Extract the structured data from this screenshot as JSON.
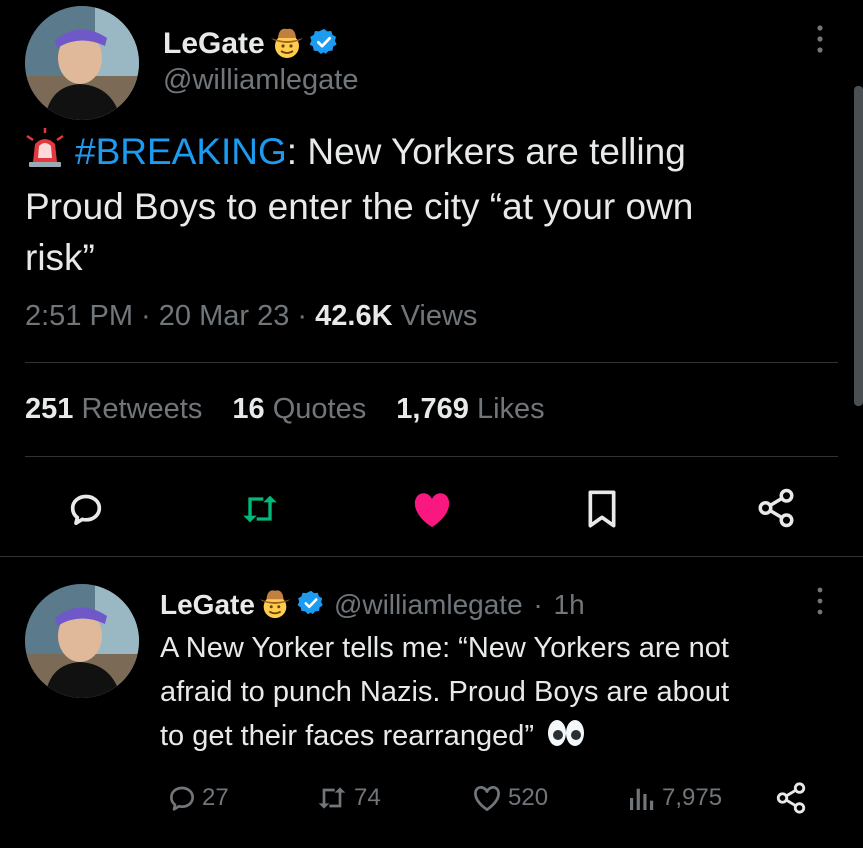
{
  "main_tweet": {
    "author": {
      "display_name": "LeGate",
      "handle": "@williamlegate",
      "name_emoji": "cowboy-hat-face",
      "verified": true
    },
    "text": {
      "emoji": "police-light",
      "hashtag": "#BREAKING",
      "body_line1": ": New Yorkers are telling",
      "body_line2": "Proud Boys to enter the city “at your own",
      "body_line3": "risk”"
    },
    "meta": {
      "time": "2:51 PM",
      "sep1": " · ",
      "date": "20 Mar 23",
      "sep2": " · ",
      "views_count": "42.6K",
      "views_label": " Views"
    },
    "stats": {
      "retweets_count": "251",
      "retweets_label": "Retweets",
      "quotes_count": "16",
      "quotes_label": "Quotes",
      "likes_count": "1,769",
      "likes_label": "Likes"
    },
    "actions": [
      "reply",
      "retweet",
      "like",
      "bookmark",
      "share"
    ],
    "colors": {
      "retweet": "#00ba7c",
      "like": "#f91880",
      "hashtag": "#1d9bf0",
      "verified": "#1d9bf0"
    }
  },
  "reply_tweet": {
    "author": {
      "display_name": "LeGate",
      "handle": "@williamlegate",
      "time_sep": " · ",
      "time_ago": "1h",
      "verified": true
    },
    "text": {
      "line1": "A New Yorker tells me: “New Yorkers are not",
      "line2": "afraid to punch Nazis. Proud Boys are about",
      "line3": "to get their faces rearranged”",
      "emoji": "eyes"
    },
    "actions": {
      "replies": "27",
      "retweets": "74",
      "likes": "520",
      "views": "7,975"
    }
  }
}
